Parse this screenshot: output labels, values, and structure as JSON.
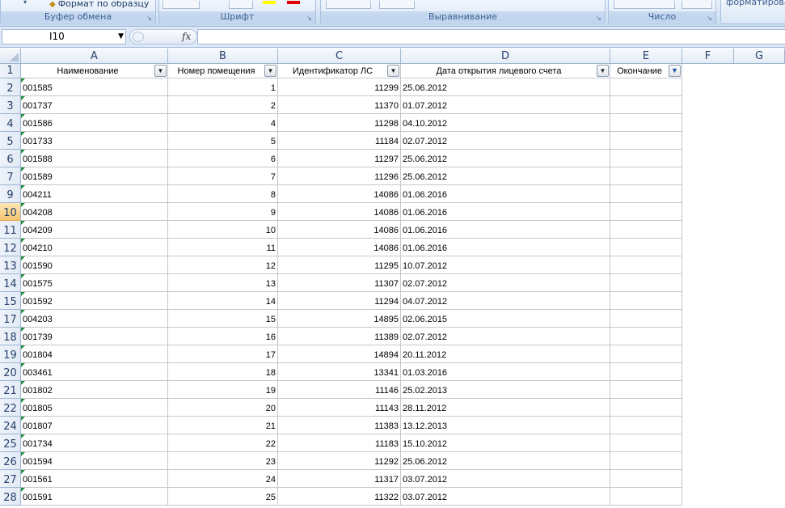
{
  "ribbon": {
    "format_painter": "Формат по образцу",
    "groups": [
      "Буфер обмена",
      "Шрифт",
      "Выравнивание",
      "Число"
    ],
    "cut_text": "форматирова"
  },
  "formula_bar": {
    "name_box": "I10",
    "fx": "fx",
    "formula": ""
  },
  "columns": [
    "A",
    "B",
    "C",
    "D",
    "E",
    "F",
    "G"
  ],
  "headers": [
    "Наименование",
    "Номер помещения",
    "Идентификатор ЛС",
    "Дата открытия лицевого счета",
    "Окончание"
  ],
  "header_row_number": "1",
  "rows": [
    {
      "num": "2",
      "name": "001585",
      "room": "1",
      "id": "11299",
      "date": "25.06.2012"
    },
    {
      "num": "3",
      "name": "001737",
      "room": "2",
      "id": "11370",
      "date": "01.07.2012"
    },
    {
      "num": "4",
      "name": "001586",
      "room": "4",
      "id": "11298",
      "date": "04.10.2012"
    },
    {
      "num": "5",
      "name": "001733",
      "room": "5",
      "id": "11184",
      "date": "02.07.2012"
    },
    {
      "num": "6",
      "name": "001588",
      "room": "6",
      "id": "11297",
      "date": "25.06.2012"
    },
    {
      "num": "7",
      "name": "001589",
      "room": "7",
      "id": "11296",
      "date": "25.06.2012"
    },
    {
      "num": "9",
      "name": "004211",
      "room": "8",
      "id": "14086",
      "date": "01.06.2016"
    },
    {
      "num": "10",
      "name": "004208",
      "room": "9",
      "id": "14086",
      "date": "01.06.2016"
    },
    {
      "num": "11",
      "name": "004209",
      "room": "10",
      "id": "14086",
      "date": "01.06.2016"
    },
    {
      "num": "12",
      "name": "004210",
      "room": "11",
      "id": "14086",
      "date": "01.06.2016"
    },
    {
      "num": "13",
      "name": "001590",
      "room": "12",
      "id": "11295",
      "date": "10.07.2012"
    },
    {
      "num": "14",
      "name": "001575",
      "room": "13",
      "id": "11307",
      "date": "02.07.2012"
    },
    {
      "num": "15",
      "name": "001592",
      "room": "14",
      "id": "11294",
      "date": "04.07.2012"
    },
    {
      "num": "17",
      "name": "004203",
      "room": "15",
      "id": "14895",
      "date": "02.06.2015"
    },
    {
      "num": "18",
      "name": "001739",
      "room": "16",
      "id": "11389",
      "date": "02.07.2012"
    },
    {
      "num": "19",
      "name": "001804",
      "room": "17",
      "id": "14894",
      "date": "20.11.2012"
    },
    {
      "num": "20",
      "name": "003461",
      "room": "18",
      "id": "13341",
      "date": "01.03.2016"
    },
    {
      "num": "21",
      "name": "001802",
      "room": "19",
      "id": "11146",
      "date": "25.02.2013"
    },
    {
      "num": "22",
      "name": "001805",
      "room": "20",
      "id": "11143",
      "date": "28.11.2012"
    },
    {
      "num": "24",
      "name": "001807",
      "room": "21",
      "id": "11383",
      "date": "13.12.2013"
    },
    {
      "num": "25",
      "name": "001734",
      "room": "22",
      "id": "11183",
      "date": "15.10.2012"
    },
    {
      "num": "26",
      "name": "001594",
      "room": "23",
      "id": "11292",
      "date": "25.06.2012"
    },
    {
      "num": "27",
      "name": "001561",
      "room": "24",
      "id": "11317",
      "date": "03.07.2012"
    },
    {
      "num": "28",
      "name": "001591",
      "room": "25",
      "id": "11322",
      "date": "03.07.2012"
    }
  ],
  "selected_row": "10",
  "colors": {
    "accent": "#f5c46f",
    "grid_line": "#c3c8cf",
    "header_text": "#27416b",
    "error_triangle": "#1e8c3a"
  }
}
